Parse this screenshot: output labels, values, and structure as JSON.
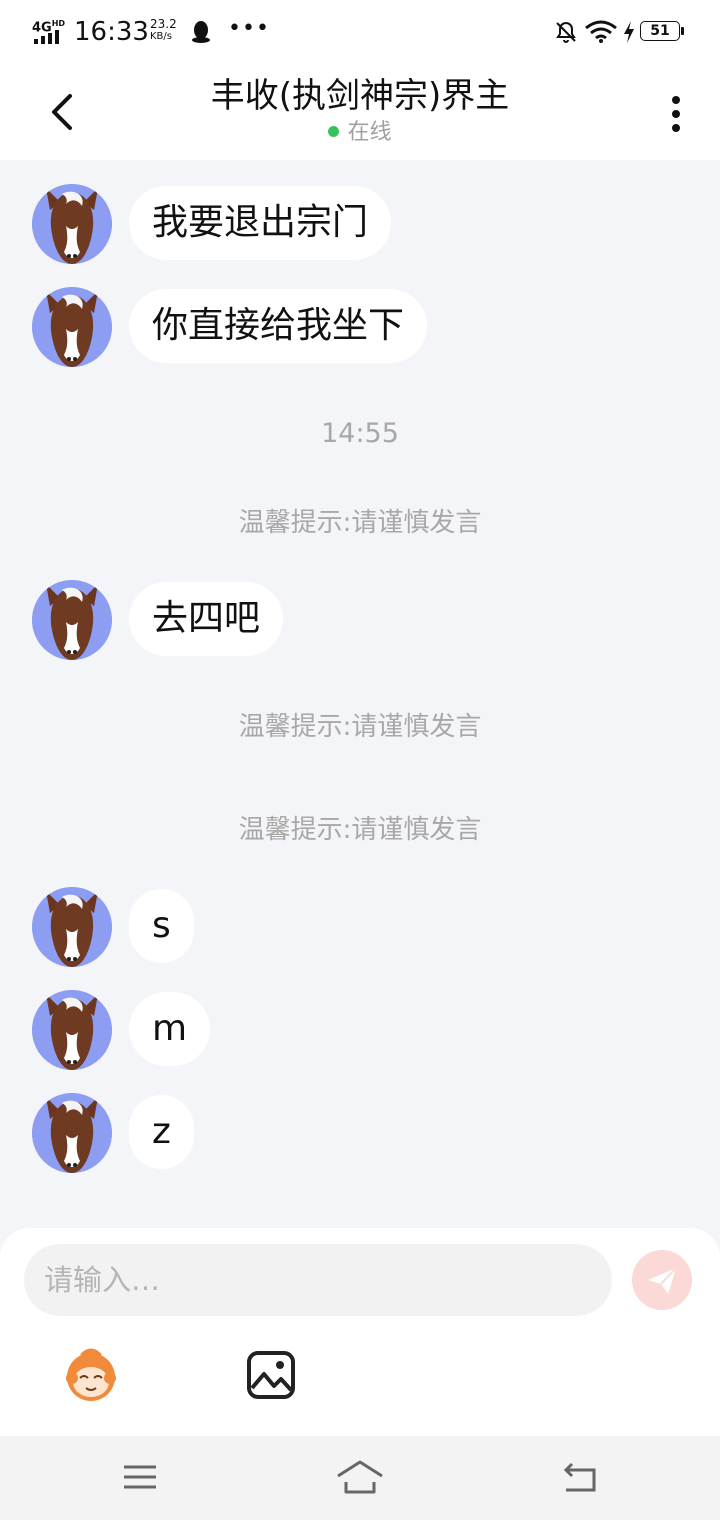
{
  "status_bar": {
    "network": "4G",
    "network_sup": "HD",
    "time": "16:33",
    "speed_value": "23.2",
    "speed_unit": "KB/s",
    "more": "•••",
    "battery": "51"
  },
  "header": {
    "title": "丰收(执剑神宗)界主",
    "online_status": "在线",
    "online_color": "#37c35a"
  },
  "messages": [
    {
      "text": "我要退出宗门"
    },
    {
      "text": "你直接给我坐下"
    },
    {
      "text": "去四吧"
    },
    {
      "text": "s"
    },
    {
      "text": "m"
    },
    {
      "text": "z"
    }
  ],
  "system": {
    "timestamp": "14:55",
    "tips": [
      "温馨提示:请谨慎发言",
      "温馨提示:请谨慎发言",
      "温馨提示:请谨慎发言"
    ]
  },
  "input_panel": {
    "placeholder": "请输入…",
    "send_color": "#fbd9d7",
    "icons": [
      "emoji-icon",
      "image-icon",
      "send-icon"
    ]
  },
  "nav_bar": {
    "icons": [
      "menu-icon",
      "home-icon",
      "back-icon"
    ]
  }
}
